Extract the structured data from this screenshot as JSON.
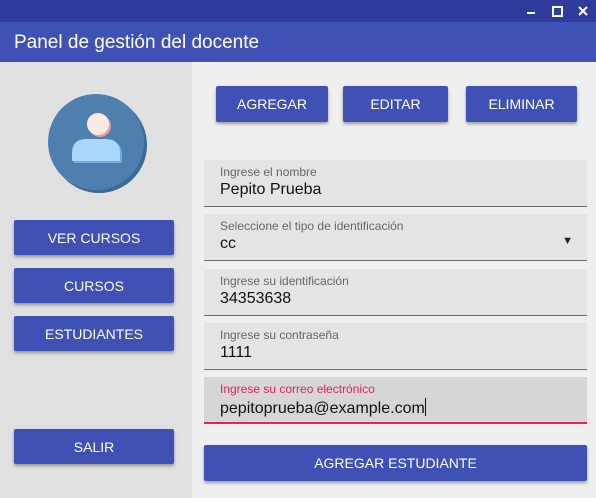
{
  "header": {
    "title": "Panel de gestión del docente"
  },
  "sidebar": {
    "buttons": [
      {
        "label": "VER CURSOS"
      },
      {
        "label": "CURSOS"
      },
      {
        "label": "ESTUDIANTES"
      }
    ],
    "exit_label": "SALIR"
  },
  "toolbar": {
    "add_label": "AGREGAR",
    "edit_label": "EDITAR",
    "delete_label": "ELIMINAR"
  },
  "form": {
    "name": {
      "label": "Ingrese el nombre",
      "value": "Pepito Prueba"
    },
    "id_type": {
      "label": "Seleccione el tipo de identificación",
      "value": "cc"
    },
    "id_number": {
      "label": "Ingrese su identificación",
      "value": "34353638"
    },
    "password": {
      "label": "Ingrese su contraseña",
      "value": "1111"
    },
    "email": {
      "label": "Ingrese su correo electrónico",
      "value": "pepitoprueba@example.com"
    },
    "submit_label": "AGREGAR ESTUDIANTE"
  },
  "colors": {
    "primary": "#3f51b5",
    "titlebar": "#2f3c9e",
    "focus_accent": "#e91e63",
    "avatar": "#4f7fae"
  },
  "icons": {
    "avatar": "user-avatar-icon",
    "dropdown": "triangle-down-icon"
  }
}
